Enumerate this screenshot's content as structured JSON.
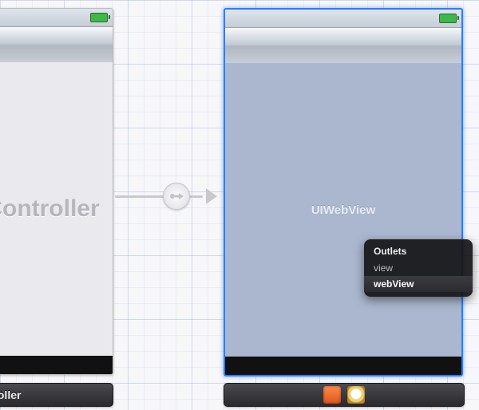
{
  "left_scene": {
    "placeholder": "Controller"
  },
  "right_scene": {
    "webview_label": "UIWebView"
  },
  "hud": {
    "title": "Outlets",
    "items": [
      "view",
      "webView"
    ],
    "selected_index": 1
  },
  "left_dock_label": "Controller",
  "colors": {
    "selection_blue": "#2a7dff",
    "webview_bg": "#aab7cf"
  }
}
